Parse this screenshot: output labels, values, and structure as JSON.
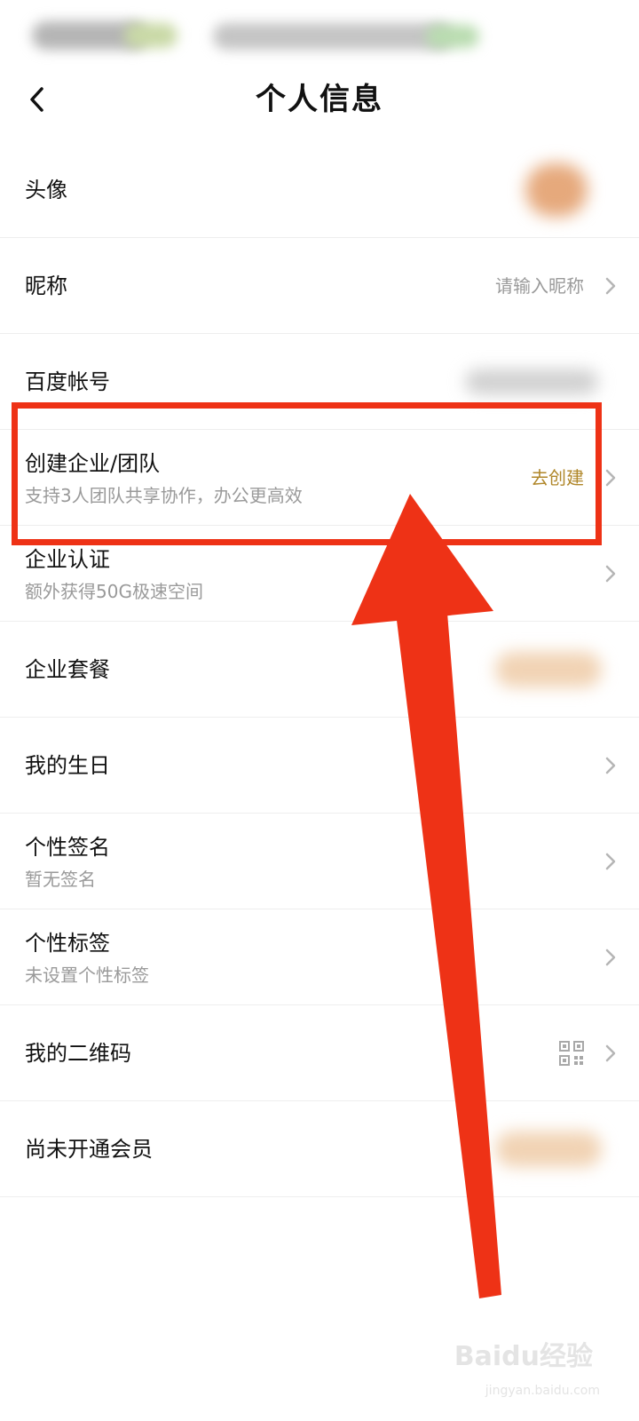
{
  "nav": {
    "title": "个人信息"
  },
  "rows": [
    {
      "label": "头像"
    },
    {
      "label": "昵称",
      "value": "请输入昵称"
    },
    {
      "label": "百度帐号"
    },
    {
      "label": "创建企业/团队",
      "sub": "支持3人团队共享协作，办公更高效",
      "action": "去创建"
    },
    {
      "label": "企业认证",
      "sub": "额外获得50G极速空间"
    },
    {
      "label": "企业套餐"
    },
    {
      "label": "我的生日"
    },
    {
      "label": "个性签名",
      "sub": "暂无签名"
    },
    {
      "label": "个性标签",
      "sub": "未设置个性标签"
    },
    {
      "label": "我的二维码"
    },
    {
      "label": "尚未开通会员"
    }
  ],
  "watermark": {
    "main": "Baidu经验",
    "sub": "jingyan.baidu.com"
  },
  "colors": {
    "highlight": "#ee3216",
    "action": "#b0872a",
    "secondary_text": "#9a9a9a"
  },
  "icons": {
    "back": "chevron-left-icon",
    "row_arrow": "chevron-right-icon",
    "qr": "qr-code-icon"
  }
}
